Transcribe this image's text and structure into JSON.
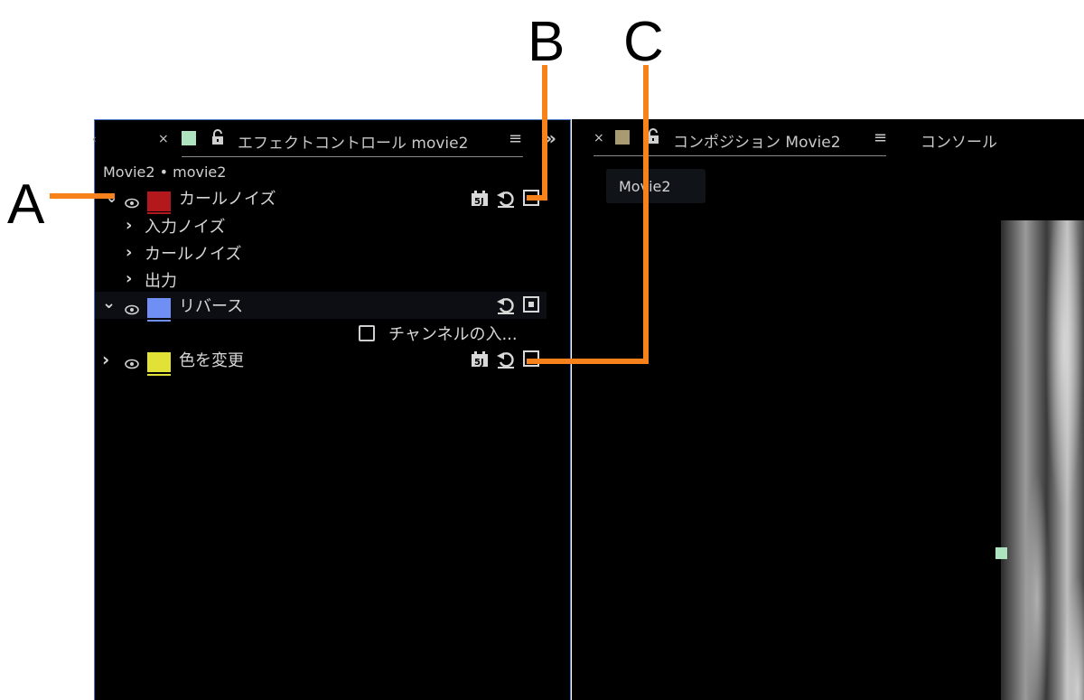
{
  "callouts": {
    "a": "A",
    "b": "B",
    "c": "C"
  },
  "colors": {
    "accent_orange": "#f7821b",
    "panel_border": "#4a78c8",
    "label_curl_noise": "#b3191c",
    "label_reverse": "#6f8ff5",
    "label_change_color": "#e2e236",
    "tab_swatch_effect": "#aee3c0",
    "tab_swatch_comp": "#a89b72"
  },
  "effect_panel": {
    "tab_close": "×",
    "tab_lock": "🔓",
    "tab_title": "エフェクトコントロール movie2",
    "tab_menu": "≡",
    "overflow": "»",
    "breadcrumb": "Movie2 • movie2",
    "effects": [
      {
        "name": "カールノイズ",
        "expanded": true
      },
      {
        "name": "リバース",
        "expanded": true
      },
      {
        "name": "色を変更",
        "expanded": false
      }
    ],
    "params": [
      "入力ノイズ",
      "カールノイズ",
      "出力"
    ],
    "reverse_option": "チャンネルの入..."
  },
  "comp_panel": {
    "tab_close": "×",
    "tab_title": "コンポジション Movie2",
    "tab_menu": "≡",
    "console_tab": "コンソール",
    "breadcrumb_button": "Movie2"
  }
}
